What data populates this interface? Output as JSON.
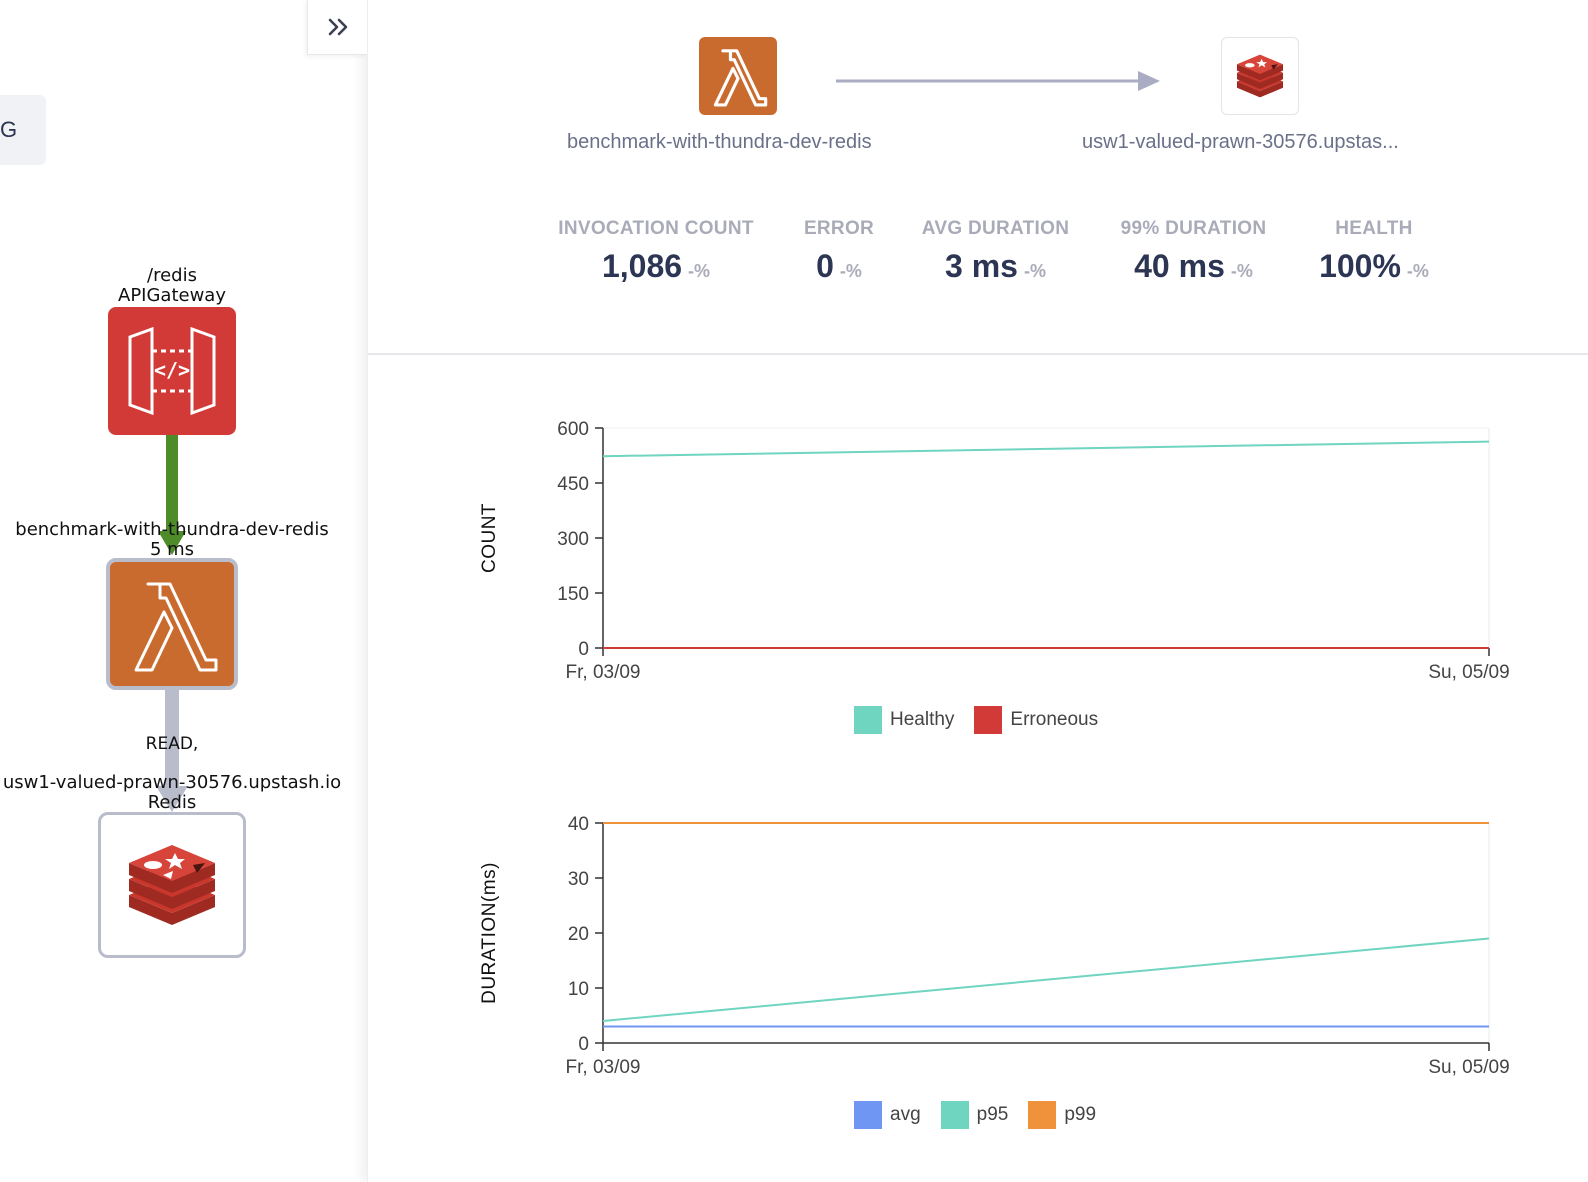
{
  "left_panel": {
    "tab_stub_text": "G",
    "nodes": {
      "apigateway": {
        "name": "/redis",
        "type": "APIGateway"
      },
      "lambda": {
        "name": "benchmark-with-thundra-dev-redis",
        "duration": "5 ms"
      },
      "redis": {
        "name": "usw1-valued-prawn-30576.upstash.io",
        "type": "Redis"
      }
    },
    "edges": {
      "lambda_to_redis_label": "READ,"
    }
  },
  "right_panel": {
    "source_name": "benchmark-with-thundra-dev-redis",
    "target_name": "usw1-valued-prawn-30576.upstas...",
    "metrics": [
      {
        "label": "INVOCATION COUNT",
        "value": "1,086",
        "delta": "-%"
      },
      {
        "label": "ERROR",
        "value": "0",
        "delta": "-%"
      },
      {
        "label": "AVG DURATION",
        "value": "3 ms",
        "delta": "-%"
      },
      {
        "label": "99% DURATION",
        "value": "40 ms",
        "delta": "-%"
      },
      {
        "label": "HEALTH",
        "value": "100%",
        "delta": "-%"
      }
    ]
  },
  "colors": {
    "healthy": "#6fd4c0",
    "erroneous": "#d13a37",
    "avg": "#6f96f2",
    "p95": "#6fd4c0",
    "p99": "#f0923b",
    "lambda_orange": "#c96b2e",
    "apigw_red": "#d13a37",
    "edge_green": "#4e8c2a",
    "edge_gray": "#b8bccb"
  },
  "chart_data": [
    {
      "type": "line",
      "ylabel": "COUNT",
      "xlabel": "",
      "x": [
        "Fr, 03/09",
        "Su, 05/09"
      ],
      "ylim": [
        0,
        600
      ],
      "yticks": [
        0,
        150,
        300,
        450,
        600
      ],
      "series": [
        {
          "name": "Healthy",
          "values": [
            523,
            563
          ]
        },
        {
          "name": "Erroneous",
          "values": [
            0,
            0
          ]
        }
      ],
      "legend": "bottom-center",
      "grid": false
    },
    {
      "type": "line",
      "ylabel": "DURATION(ms)",
      "xlabel": "",
      "x": [
        "Fr, 03/09",
        "Su, 05/09"
      ],
      "ylim": [
        0,
        40
      ],
      "yticks": [
        0,
        10,
        20,
        30,
        40
      ],
      "series": [
        {
          "name": "avg",
          "values": [
            3,
            3
          ]
        },
        {
          "name": "p95",
          "values": [
            4,
            19
          ]
        },
        {
          "name": "p99",
          "values": [
            40,
            40
          ]
        }
      ],
      "legend": "bottom-center",
      "grid": false
    }
  ]
}
